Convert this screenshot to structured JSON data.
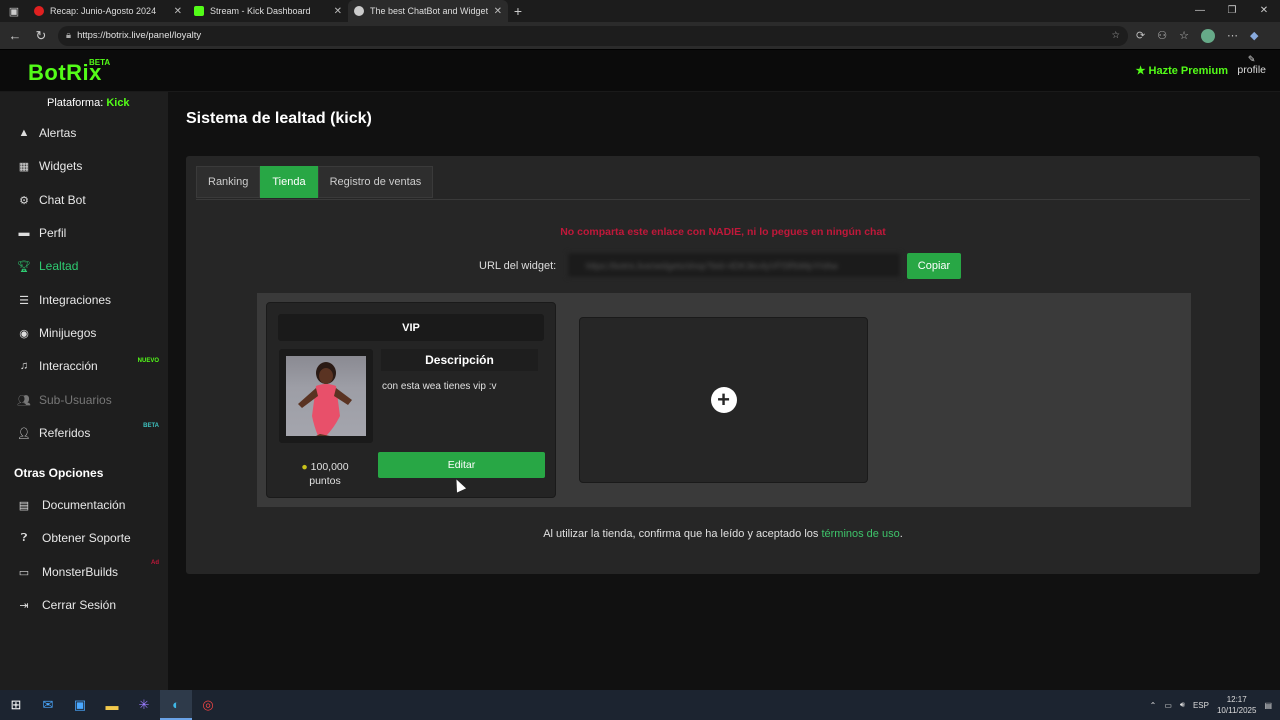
{
  "browser": {
    "tabs": [
      {
        "title": "Recap: Junio-Agosto 2024",
        "color": "#e02020"
      },
      {
        "title": "Stream - Kick Dashboard",
        "color": "#53fc18"
      },
      {
        "title": "The best ChatBot and Widgets fo",
        "color": "#cccccc"
      }
    ],
    "url": "https://botrix.live/panel/loyalty"
  },
  "header": {
    "logo": "BotRix",
    "logo_badge": "BETA",
    "premium_label": "Hazte Premium",
    "profile_label": "profile"
  },
  "sidebar": {
    "platform_label": "Plataforma:",
    "platform_value": "Kick",
    "items": [
      {
        "label": "Alertas",
        "icon": "warning-icon"
      },
      {
        "label": "Widgets",
        "icon": "grid-icon"
      },
      {
        "label": "Chat Bot",
        "icon": "robot-icon"
      },
      {
        "label": "Perfil",
        "icon": "id-card-icon"
      },
      {
        "label": "Lealtad",
        "icon": "trophy-icon"
      },
      {
        "label": "Integraciones",
        "icon": "list-icon"
      },
      {
        "label": "Minijuegos",
        "icon": "gamepad-icon"
      },
      {
        "label": "Interacción",
        "icon": "music-icon",
        "badge": "NUEVO"
      },
      {
        "label": "Sub-Usuarios",
        "icon": "users-icon"
      },
      {
        "label": "Referidos",
        "icon": "user-plus-icon",
        "badge": "BETA"
      }
    ],
    "other_title": "Otras Opciones",
    "other_items": [
      {
        "label": "Documentación",
        "icon": "docs-icon"
      },
      {
        "label": "Obtener Soporte",
        "icon": "help-icon"
      },
      {
        "label": "MonsterBuilds",
        "icon": "laptop-icon",
        "badge": "Ad"
      },
      {
        "label": "Cerrar Sesión",
        "icon": "logout-icon"
      }
    ]
  },
  "main": {
    "title": "Sistema de lealtad (kick)",
    "tabs": [
      "Ranking",
      "Tienda",
      "Registro de ventas"
    ],
    "warning": "No comparta este enlace con NADIE, ni lo pegues en ningún chat",
    "url_label": "URL del widget:",
    "url_value": "https://botrix.live/widgets/shop?bid=4DK3kn4yVFf3RbMpYHAw",
    "copy_label": "Copiar",
    "item": {
      "name": "VIP",
      "desc_title": "Descripción",
      "description": "con esta wea tienes vip :v",
      "price": "100,000",
      "price_unit": "puntos",
      "edit_label": "Editar"
    },
    "terms_prefix": "Al utilizar la tienda, confirma que ha leído y aceptado los ",
    "terms_link": "términos de uso",
    "terms_suffix": "."
  },
  "taskbar": {
    "lang": "ESP",
    "time": "12:17",
    "date": "10/11/2025"
  },
  "colors": {
    "accent": "#28a745",
    "brand": "#53fc18",
    "warning": "#c0183a"
  }
}
